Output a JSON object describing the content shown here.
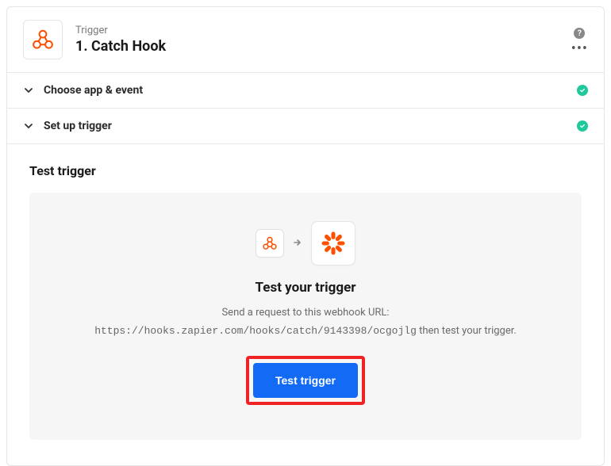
{
  "header": {
    "kicker": "Trigger",
    "title": "1. Catch Hook"
  },
  "sections": {
    "chooseApp": "Choose app & event",
    "setupTrigger": "Set up trigger",
    "testTrigger": "Test trigger"
  },
  "test": {
    "title": "Test your trigger",
    "desc": "Send a request to this webhook URL:",
    "url": "https://hooks.zapier.com/hooks/catch/9143398/ocgojlg",
    "tail": " then test your trigger.",
    "button": "Test trigger"
  }
}
